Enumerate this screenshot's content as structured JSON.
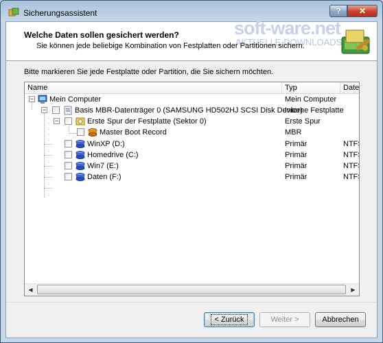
{
  "window": {
    "title": "Sicherungsassistent",
    "help_label": "?",
    "close_label": "✕"
  },
  "header": {
    "title": "Welche Daten sollen gesichert werden?",
    "subtitle": "Sie können jede beliebige Kombination von Festplatten oder Partitionen sichern.",
    "watermark": "soft-ware.net",
    "watermark_sub": "AKTUELLE DOWNLOADS"
  },
  "instruction": "Bitte markieren Sie jede Festplatte oder Partition, die Sie sichern möchten.",
  "table": {
    "columns": [
      "Name",
      "Typ",
      "Dateisystem"
    ],
    "rows": [
      {
        "name": "Mein Computer",
        "type": "Mein Computer",
        "fs": "",
        "icon": "computer-icon"
      },
      {
        "name": "Basis MBR-Datenträger 0 (SAMSUNG HD502HJ SCSI Disk Device)",
        "type": "Interne Festplatte",
        "fs": "",
        "icon": "disk-icon"
      },
      {
        "name": "Erste Spur der Festplatte (Sektor 0)",
        "type": "Erste Spur",
        "fs": "",
        "icon": "track-icon"
      },
      {
        "name": "Master Boot Record",
        "type": "MBR",
        "fs": "",
        "icon": "mbr-icon"
      },
      {
        "name": "WinXP (D:)",
        "type": "Primär",
        "fs": "NTFS",
        "icon": "partition-icon"
      },
      {
        "name": "Homedrive (C:)",
        "type": "Primär",
        "fs": "NTFS",
        "icon": "partition-icon"
      },
      {
        "name": "Win7 (E:)",
        "type": "Primär",
        "fs": "NTFS",
        "icon": "partition-icon"
      },
      {
        "name": "Daten (F:)",
        "type": "Primär",
        "fs": "NTFS",
        "icon": "partition-icon"
      }
    ]
  },
  "buttons": {
    "back": "< Zurück",
    "next": "Weiter >",
    "cancel": "Abbrechen"
  },
  "colors": {
    "title_bar": "#a9c2da",
    "close_button": "#c9402a",
    "partition_icon": "#3b63d1"
  }
}
